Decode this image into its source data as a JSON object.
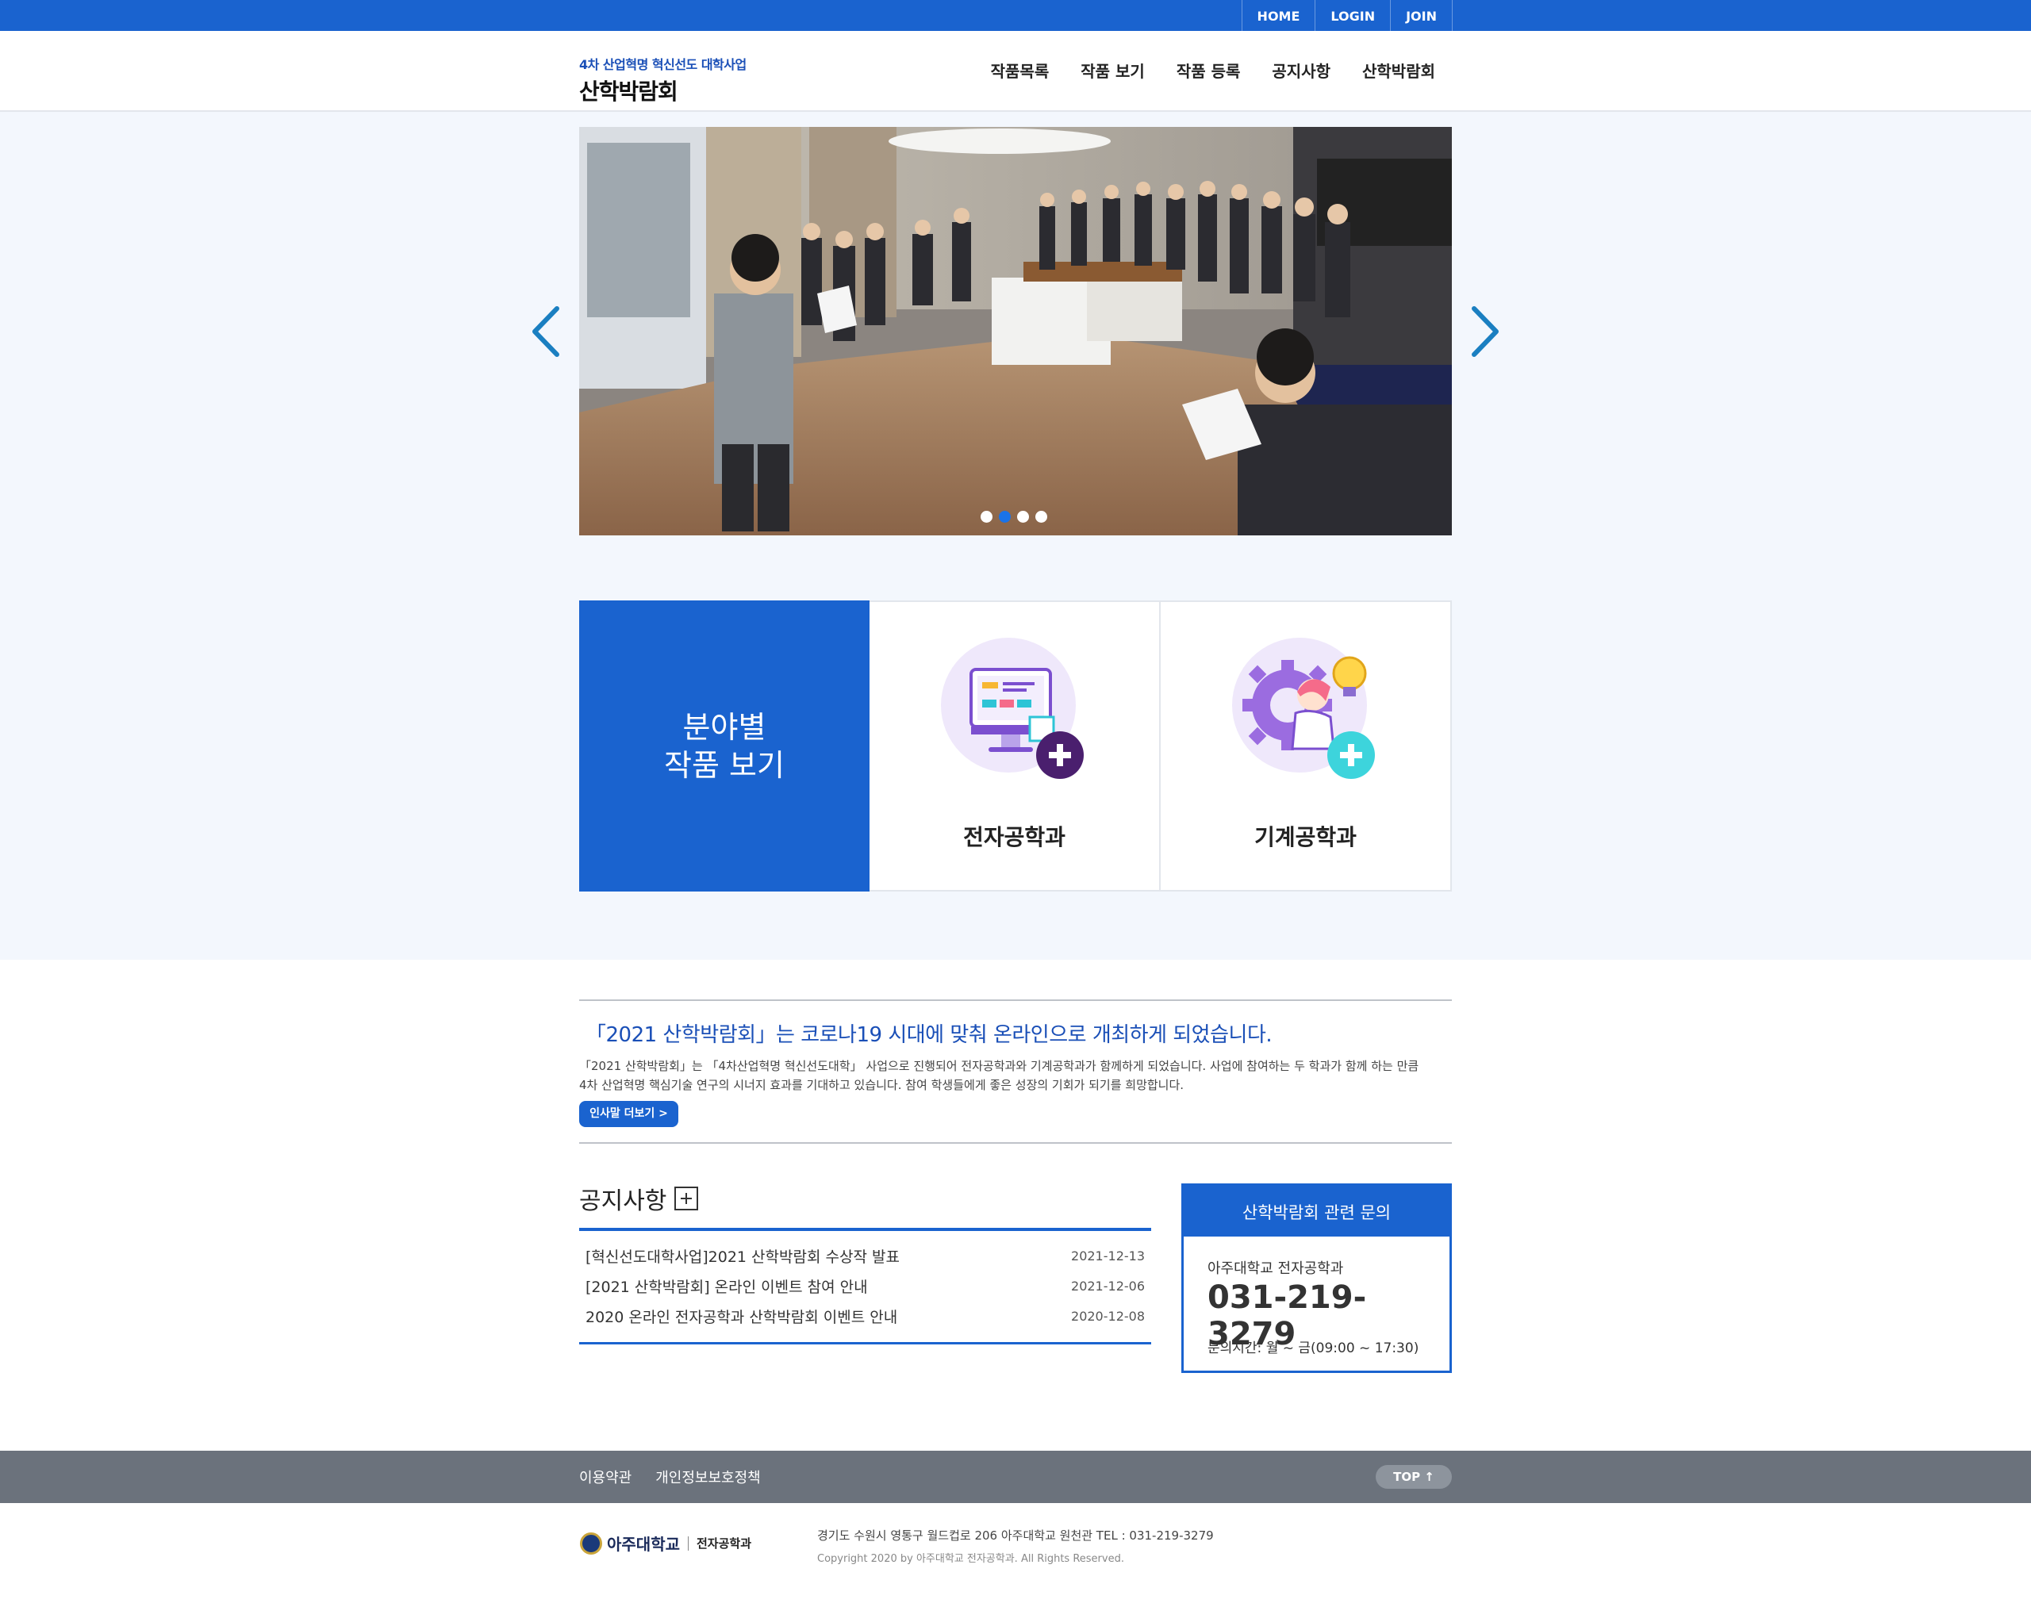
{
  "topbar": {
    "links": [
      "HOME",
      "LOGIN",
      "JOIN"
    ]
  },
  "header": {
    "logo_sub": "4차 산업혁명 혁신선도 대학사업",
    "logo_main": "산학박람회",
    "nav": [
      "작품목록",
      "작품 보기",
      "작품 등록",
      "공지사항",
      "산학박람회"
    ]
  },
  "slider": {
    "slide_count": 4,
    "active_index": 1
  },
  "categories": {
    "title_line1": "분야별",
    "title_line2": "작품 보기",
    "items": [
      {
        "label": "전자공학과",
        "icon": "computer-icon"
      },
      {
        "label": "기계공학과",
        "icon": "gear-idea-icon"
      }
    ]
  },
  "intro": {
    "heading": "「2021 산학박람회」는 코로나19 시대에 맞춰 온라인으로 개최하게 되었습니다.",
    "body": "「2021 산학박람회」는 「4차산업혁명 혁신선도대학」 사업으로 진행되어 전자공학과와 기계공학과가 함께하게 되었습니다. 사업에 참여하는 두 학과가 함께 하는 만큼 4차 산업혁명 핵심기술 연구의 시너지 효과를 기대하고 있습니다. 참여 학생들에게 좋은 성장의 기회가 되기를 희망합니다.",
    "more_label": "인사말 더보기 >"
  },
  "notice": {
    "title": "공지사항",
    "items": [
      {
        "title": "[혁신선도대학사업]2021 산학박람회 수상작 발표",
        "date": "2021-12-13"
      },
      {
        "title": "[2021 산학박람회] 온라인 이벤트 참여 안내",
        "date": "2021-12-06"
      },
      {
        "title": "2020 온라인 전자공학과 산학박람회 이벤트 안내",
        "date": "2020-12-08"
      }
    ]
  },
  "contact": {
    "title": "산학박람회 관련 문의",
    "dept": "아주대학교 전자공학과",
    "phone": "031-219-3279",
    "hours": "문의시간: 월 ~ 금(09:00 ~ 17:30)"
  },
  "footer": {
    "links": [
      "이용약관",
      "개인정보보호정책"
    ],
    "top_label": "TOP ↑",
    "logo_name": "아주대학교",
    "logo_dept": "전자공학과",
    "address": "경기도 수원시 영통구 월드컵로 206 아주대학교 원천관 TEL : 031-219-3279",
    "copyright": "Copyright 2020 by 아주대학교 전자공학과. All Rights Reserved."
  },
  "colors": {
    "brand_blue": "#1a63cf",
    "footer_gray": "#6b727c",
    "hero_bg": "#f3f7fd"
  }
}
